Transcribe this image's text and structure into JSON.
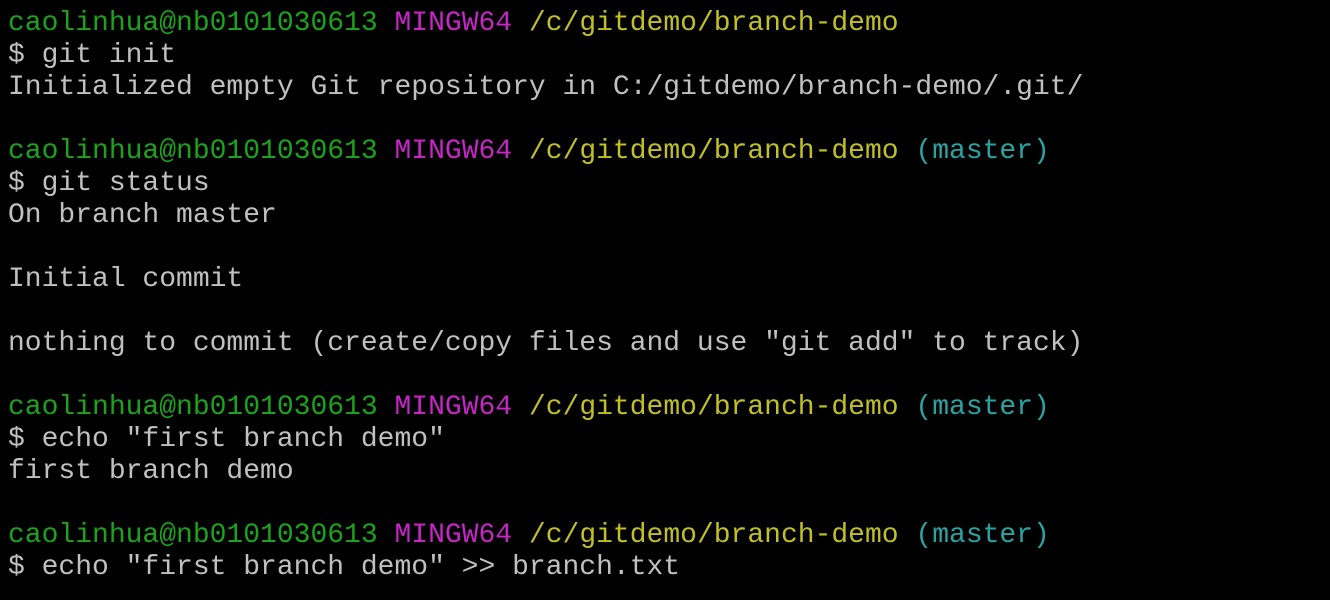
{
  "terminal": {
    "blocks": [
      {
        "prompt": {
          "user_host": "caolinhua@nb0101030613",
          "system": "MINGW64",
          "path": "/c/gitdemo/branch-demo",
          "branch": ""
        },
        "command": "$ git init",
        "output": [
          "Initialized empty Git repository in C:/gitdemo/branch-demo/.git/"
        ]
      },
      {
        "prompt": {
          "user_host": "caolinhua@nb0101030613",
          "system": "MINGW64",
          "path": "/c/gitdemo/branch-demo",
          "branch": "(master)"
        },
        "command": "$ git status",
        "output": [
          "On branch master",
          "",
          "Initial commit",
          "",
          "nothing to commit (create/copy files and use \"git add\" to track)"
        ]
      },
      {
        "prompt": {
          "user_host": "caolinhua@nb0101030613",
          "system": "MINGW64",
          "path": "/c/gitdemo/branch-demo",
          "branch": "(master)"
        },
        "command": "$ echo \"first branch demo\"",
        "output": [
          "first branch demo"
        ]
      },
      {
        "prompt": {
          "user_host": "caolinhua@nb0101030613",
          "system": "MINGW64",
          "path": "/c/gitdemo/branch-demo",
          "branch": "(master)"
        },
        "command": "$ echo \"first branch demo\" >> branch.txt",
        "output": []
      }
    ]
  },
  "colors": {
    "background": "#000000",
    "user_host": "#1ca31c",
    "system": "#c726c7",
    "path": "#c0c026",
    "branch": "#2aa3a3",
    "text": "#c0c0c0"
  }
}
